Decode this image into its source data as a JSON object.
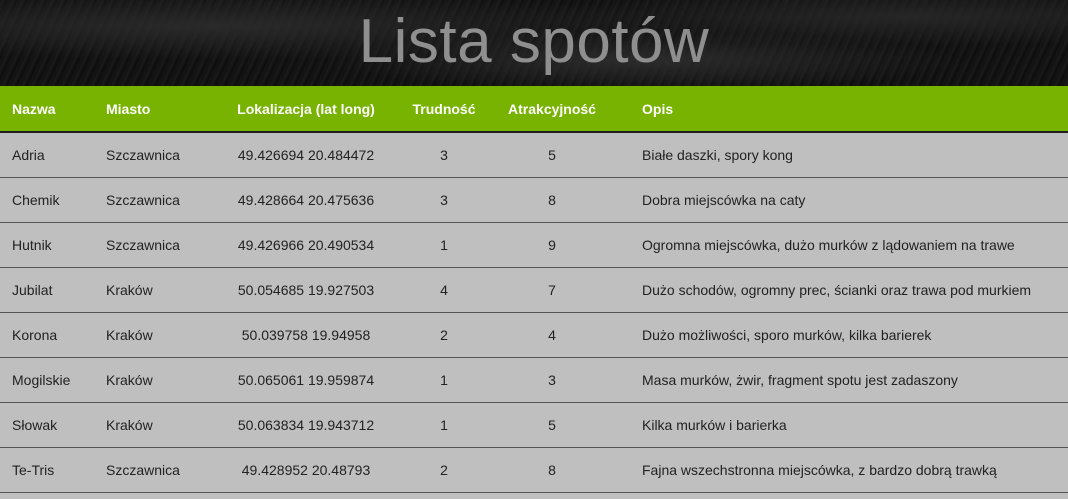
{
  "page": {
    "title": "Lista spotów"
  },
  "table": {
    "headers": {
      "name": "Nazwa",
      "city": "Miasto",
      "location": "Lokalizacja (lat long)",
      "difficulty": "Trudność",
      "attractiveness": "Atrakcyjność",
      "description": "Opis"
    },
    "rows": [
      {
        "name": "Adria",
        "city": "Szczawnica",
        "location": "49.426694 20.484472",
        "difficulty": "3",
        "attractiveness": "5",
        "description": "Białe daszki, spory kong"
      },
      {
        "name": "Chemik",
        "city": "Szczawnica",
        "location": "49.428664 20.475636",
        "difficulty": "3",
        "attractiveness": "8",
        "description": "Dobra miejscówka na caty"
      },
      {
        "name": "Hutnik",
        "city": "Szczawnica",
        "location": "49.426966 20.490534",
        "difficulty": "1",
        "attractiveness": "9",
        "description": "Ogromna miejscówka, dużo murków z lądowaniem na trawe"
      },
      {
        "name": "Jubilat",
        "city": "Kraków",
        "location": "50.054685 19.927503",
        "difficulty": "4",
        "attractiveness": "7",
        "description": "Dużo schodów, ogromny prec, ścianki oraz trawa pod murkiem"
      },
      {
        "name": "Korona",
        "city": "Kraków",
        "location": "50.039758 19.94958",
        "difficulty": "2",
        "attractiveness": "4",
        "description": "Dużo możliwości, sporo murków, kilka barierek"
      },
      {
        "name": "Mogilskie",
        "city": "Kraków",
        "location": "50.065061 19.959874",
        "difficulty": "1",
        "attractiveness": "3",
        "description": "Masa murków, żwir, fragment spotu jest zadaszony"
      },
      {
        "name": "Słowak",
        "city": "Kraków",
        "location": "50.063834 19.943712",
        "difficulty": "1",
        "attractiveness": "5",
        "description": "Kilka murków i barierka"
      },
      {
        "name": "Te-Tris",
        "city": "Szczawnica",
        "location": "49.428952 20.48793",
        "difficulty": "2",
        "attractiveness": "8",
        "description": "Fajna wszechstronna miejscówka, z bardzo dobrą trawką"
      }
    ]
  },
  "colors": {
    "header_bar": "#77b300",
    "table_bg": "#bfbfbf",
    "title_text": "#8f8f8f",
    "banner_bg": "#111111"
  }
}
